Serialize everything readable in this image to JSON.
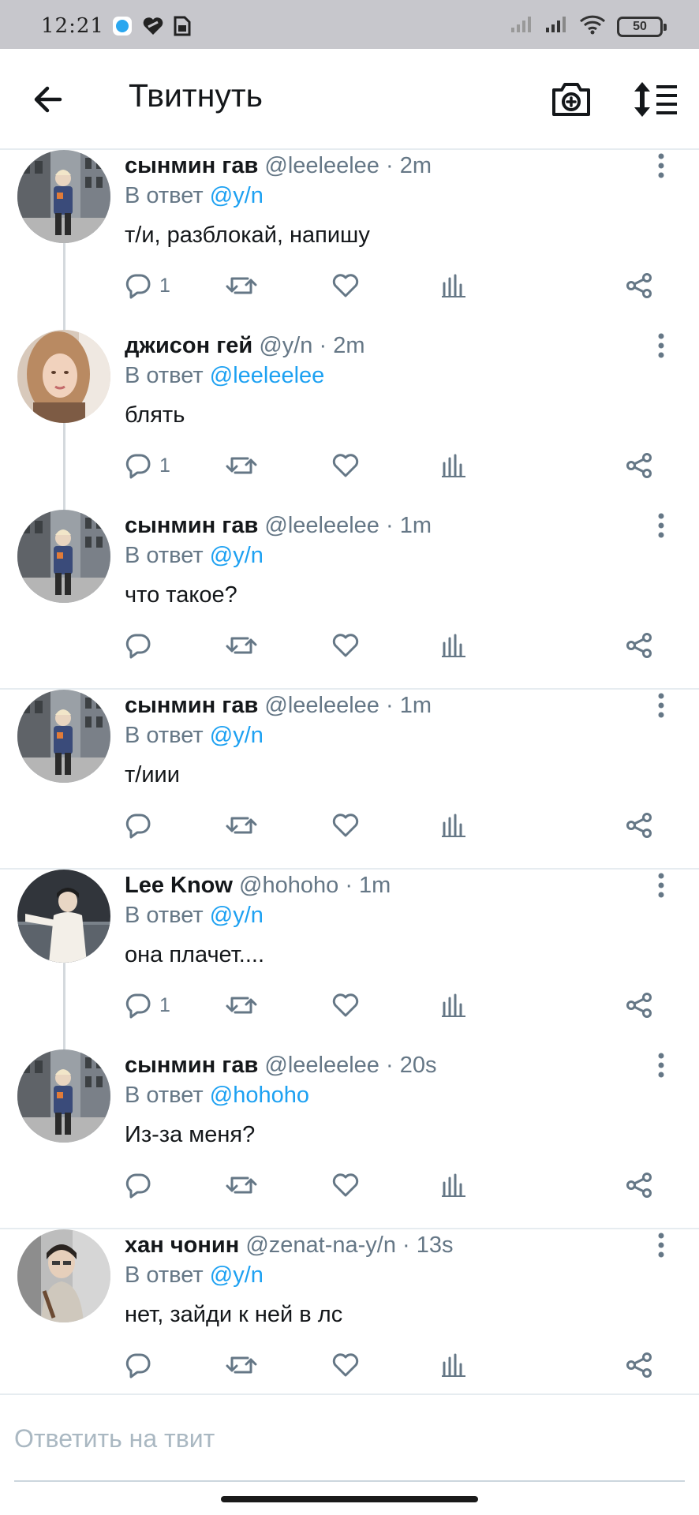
{
  "status_bar": {
    "time": "12:21",
    "battery": "50",
    "icons": [
      "app-notification-icon",
      "heart-notification-icon",
      "sim-card-icon",
      "signal-icon",
      "signal-icon",
      "wifi-icon",
      "battery-icon"
    ]
  },
  "app_bar": {
    "title": "Твитнуть",
    "icons": [
      "back-arrow-icon",
      "camera-plus-icon",
      "sort-icon"
    ]
  },
  "colors": {
    "accent": "#1da1f2",
    "muted": "#657786",
    "text": "#14171a",
    "divider": "#e6ecf0"
  },
  "reply_prefix": "В ответ",
  "tweets": [
    {
      "name": "сынмин гав",
      "handle": "@leeleelee",
      "time": "2m",
      "reply_to": "@y/n",
      "text": "т/и, разблокай, напишу",
      "reply_count": "1",
      "avatar": "seungmin"
    },
    {
      "name": "джисон гей",
      "handle": "@y/n",
      "time": "2m",
      "reply_to": "@leeleelee",
      "text": "блять",
      "reply_count": "1",
      "avatar": "girl"
    },
    {
      "name": "сынмин гав",
      "handle": "@leeleelee",
      "time": "1m",
      "reply_to": "@y/n",
      "text": "что такое?",
      "reply_count": "",
      "avatar": "seungmin"
    },
    {
      "name": "сынмин гав",
      "handle": "@leeleelee",
      "time": "1m",
      "reply_to": "@y/n",
      "text": "т/иии",
      "reply_count": "",
      "avatar": "seungmin"
    },
    {
      "name": "Lee Know",
      "handle": "@hohoho",
      "time": "1m",
      "reply_to": "@y/n",
      "text": "она плачет....",
      "reply_count": "1",
      "avatar": "leeknow"
    },
    {
      "name": "сынмин гав",
      "handle": "@leeleelee",
      "time": "20s",
      "reply_to": "@hohoho",
      "text": "Из-за меня?",
      "reply_count": "",
      "avatar": "seungmin"
    },
    {
      "name": "хан чонин",
      "handle": "@zenat-na-y/n",
      "time": "13s",
      "reply_to": "@y/n",
      "text": "нет, зайди к ней в лс",
      "reply_count": "",
      "avatar": "jeongin"
    }
  ],
  "composer": {
    "placeholder": "Ответить на твит"
  }
}
